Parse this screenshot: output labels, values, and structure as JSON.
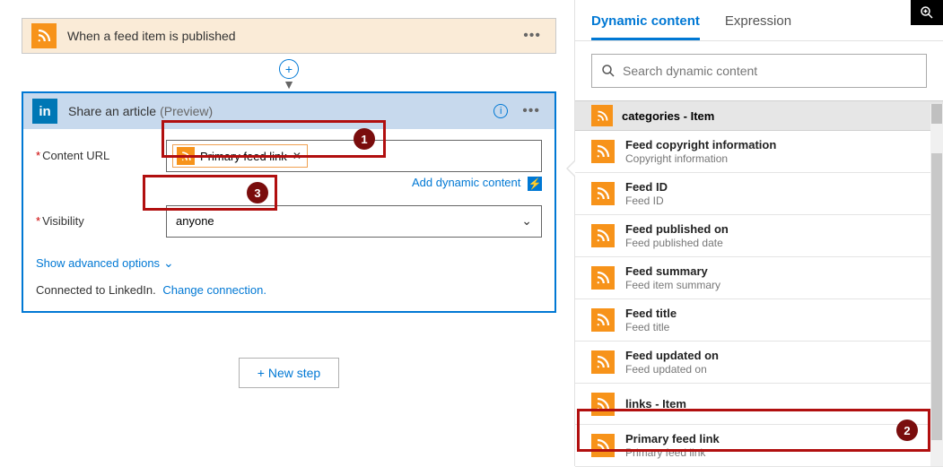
{
  "trigger": {
    "title": "When a feed item is published"
  },
  "action": {
    "title": "Share an article",
    "preview": "(Preview)",
    "fields": {
      "content_url_label": "Content URL",
      "content_url_token": "Primary feed link",
      "visibility_label": "Visibility",
      "visibility_value": "anyone"
    },
    "add_dynamic": "Add dynamic content",
    "advanced": "Show advanced options",
    "connected_prefix": "Connected to LinkedIn.",
    "change_conn": "Change connection."
  },
  "new_step": "+ New step",
  "panel": {
    "tabs": {
      "dynamic": "Dynamic content",
      "expression": "Expression"
    },
    "search_placeholder": "Search dynamic content",
    "section": "categories - Item",
    "items": [
      {
        "title": "Feed copyright information",
        "sub": "Copyright information"
      },
      {
        "title": "Feed ID",
        "sub": "Feed ID"
      },
      {
        "title": "Feed published on",
        "sub": "Feed published date"
      },
      {
        "title": "Feed summary",
        "sub": "Feed item summary"
      },
      {
        "title": "Feed title",
        "sub": "Feed title"
      },
      {
        "title": "Feed updated on",
        "sub": "Feed updated on"
      },
      {
        "title": "links - Item",
        "sub": ""
      },
      {
        "title": "Primary feed link",
        "sub": "Primary feed link"
      }
    ]
  },
  "callouts": {
    "c1": "1",
    "c2": "2",
    "c3": "3"
  }
}
